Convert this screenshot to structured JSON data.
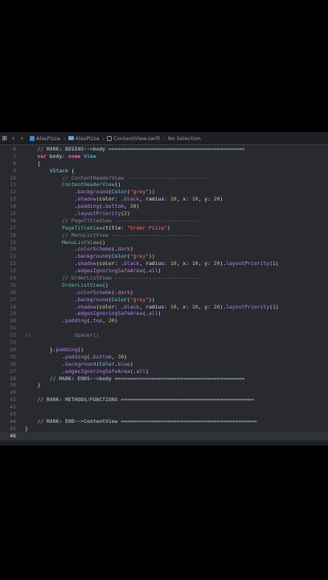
{
  "toolbar": {
    "breadcrumbs": [
      {
        "label": "AlasPizza",
        "icon": "project-icon"
      },
      {
        "label": "AlasPizza",
        "icon": "folder-icon"
      },
      {
        "label": "ContentView.swift",
        "icon": "swift-file-icon"
      }
    ],
    "selection": "No Selection"
  },
  "current_line": "46",
  "lines": [
    {
      "n": "6",
      "t": [
        [
          "mark",
          "    // MARK: BEGINS-->body ============================================"
        ]
      ]
    },
    {
      "n": "7",
      "t": [
        [
          "kw",
          "    var "
        ],
        [
          "plain",
          "body: "
        ],
        [
          "kw",
          "some "
        ],
        [
          "type",
          "View"
        ]
      ]
    },
    {
      "n": "8",
      "t": [
        [
          "plain",
          "    {"
        ]
      ]
    },
    {
      "n": "9",
      "t": [
        [
          "plain",
          "        "
        ],
        [
          "type",
          "VStack"
        ],
        [
          "plain",
          " {"
        ]
      ]
    },
    {
      "n": "10",
      "t": [
        [
          "com",
          "            // ContentHeaderView --------------------------"
        ]
      ]
    },
    {
      "n": "11",
      "t": [
        [
          "plain",
          "            "
        ],
        [
          "func",
          "ContentHeaderView"
        ],
        [
          "plain",
          "()"
        ]
      ]
    },
    {
      "n": "12",
      "t": [
        [
          "plain",
          "                ."
        ],
        [
          "fn",
          "background"
        ],
        [
          "plain",
          "("
        ],
        [
          "type",
          "Color"
        ],
        [
          "plain",
          "("
        ],
        [
          "str",
          "\"grey\""
        ],
        [
          "plain",
          "))"
        ]
      ]
    },
    {
      "n": "13",
      "t": [
        [
          "plain",
          "                ."
        ],
        [
          "fn",
          "shadow"
        ],
        [
          "plain",
          "(color: ."
        ],
        [
          "fn",
          "black"
        ],
        [
          "plain",
          ", radius: "
        ],
        [
          "num",
          "10"
        ],
        [
          "plain",
          ", x: "
        ],
        [
          "num",
          "10"
        ],
        [
          "plain",
          ", y: "
        ],
        [
          "num",
          "20"
        ],
        [
          "plain",
          ")"
        ]
      ]
    },
    {
      "n": "14",
      "t": [
        [
          "plain",
          "                ."
        ],
        [
          "fn",
          "padding"
        ],
        [
          "plain",
          "(."
        ],
        [
          "fn",
          "bottom"
        ],
        [
          "plain",
          ", "
        ],
        [
          "num",
          "20"
        ],
        [
          "plain",
          ")"
        ]
      ]
    },
    {
      "n": "15",
      "t": [
        [
          "plain",
          "                ."
        ],
        [
          "fn",
          "layoutPriority"
        ],
        [
          "plain",
          "("
        ],
        [
          "num",
          "2"
        ],
        [
          "plain",
          ")"
        ]
      ]
    },
    {
      "n": "16",
      "t": [
        [
          "com",
          "            // PageTitleView ---------------------------"
        ]
      ]
    },
    {
      "n": "17",
      "t": [
        [
          "plain",
          "            "
        ],
        [
          "func",
          "PageTitleView"
        ],
        [
          "plain",
          "(title: "
        ],
        [
          "str",
          "\"Order Pizza\""
        ],
        [
          "plain",
          ")"
        ]
      ]
    },
    {
      "n": "18",
      "t": [
        [
          "com",
          "            // MenuListView ----------------------------"
        ]
      ]
    },
    {
      "n": "19",
      "t": [
        [
          "plain",
          "            "
        ],
        [
          "func",
          "MenuListView"
        ],
        [
          "plain",
          "()"
        ]
      ]
    },
    {
      "n": "20",
      "t": [
        [
          "plain",
          "                ."
        ],
        [
          "fn",
          "colorScheme"
        ],
        [
          "plain",
          "(."
        ],
        [
          "fn",
          "dark"
        ],
        [
          "plain",
          ")"
        ]
      ]
    },
    {
      "n": "21",
      "t": [
        [
          "plain",
          "                ."
        ],
        [
          "fn",
          "background"
        ],
        [
          "plain",
          "("
        ],
        [
          "type",
          "Color"
        ],
        [
          "plain",
          "("
        ],
        [
          "str",
          "\"grey\""
        ],
        [
          "plain",
          "))"
        ]
      ]
    },
    {
      "n": "22",
      "t": [
        [
          "plain",
          "                ."
        ],
        [
          "fn",
          "shadow"
        ],
        [
          "plain",
          "(color: ."
        ],
        [
          "fn",
          "black"
        ],
        [
          "plain",
          ", radius: "
        ],
        [
          "num",
          "10"
        ],
        [
          "plain",
          ", x: "
        ],
        [
          "num",
          "10"
        ],
        [
          "plain",
          ", y: "
        ],
        [
          "num",
          "20"
        ],
        [
          "plain",
          ")."
        ],
        [
          "fn",
          "layoutPriority"
        ],
        [
          "plain",
          "("
        ],
        [
          "num",
          "1"
        ],
        [
          "plain",
          ")"
        ]
      ]
    },
    {
      "n": "23",
      "t": [
        [
          "plain",
          "                ."
        ],
        [
          "fn",
          "edgesIgnoringSafeArea"
        ],
        [
          "plain",
          "(."
        ],
        [
          "fn",
          "all"
        ],
        [
          "plain",
          ")"
        ]
      ]
    },
    {
      "n": "24",
      "t": [
        [
          "com",
          "            // OrderListView ---------------------------"
        ]
      ]
    },
    {
      "n": "25",
      "t": [
        [
          "plain",
          "            "
        ],
        [
          "func",
          "OrderListView"
        ],
        [
          "plain",
          "()"
        ]
      ]
    },
    {
      "n": "26",
      "t": [
        [
          "plain",
          "                ."
        ],
        [
          "fn",
          "colorScheme"
        ],
        [
          "plain",
          "(."
        ],
        [
          "fn",
          "dark"
        ],
        [
          "plain",
          ")"
        ]
      ]
    },
    {
      "n": "27",
      "t": [
        [
          "plain",
          "                ."
        ],
        [
          "fn",
          "background"
        ],
        [
          "plain",
          "("
        ],
        [
          "type",
          "Color"
        ],
        [
          "plain",
          "("
        ],
        [
          "str",
          "\"grey\""
        ],
        [
          "plain",
          "))"
        ]
      ]
    },
    {
      "n": "28",
      "t": [
        [
          "plain",
          "                ."
        ],
        [
          "fn",
          "shadow"
        ],
        [
          "plain",
          "(color: ."
        ],
        [
          "fn",
          "black"
        ],
        [
          "plain",
          ", radius: "
        ],
        [
          "num",
          "10"
        ],
        [
          "plain",
          ", x: "
        ],
        [
          "num",
          "10"
        ],
        [
          "plain",
          ", y: "
        ],
        [
          "num",
          "20"
        ],
        [
          "plain",
          ")."
        ],
        [
          "fn",
          "layoutPriority"
        ],
        [
          "plain",
          "("
        ],
        [
          "num",
          "1"
        ],
        [
          "plain",
          ")"
        ]
      ]
    },
    {
      "n": "29",
      "t": [
        [
          "plain",
          "                ."
        ],
        [
          "fn",
          "edgesIgnoringSafeArea"
        ],
        [
          "plain",
          "(."
        ],
        [
          "fn",
          "all"
        ],
        [
          "plain",
          ")"
        ]
      ]
    },
    {
      "n": "30",
      "t": [
        [
          "plain",
          "            ."
        ],
        [
          "fn",
          "padding"
        ],
        [
          "plain",
          "(."
        ],
        [
          "fn",
          "top"
        ],
        [
          "plain",
          ", "
        ],
        [
          "num",
          "20"
        ],
        [
          "plain",
          ")"
        ]
      ]
    },
    {
      "n": "31",
      "t": []
    },
    {
      "n": "32",
      "t": [
        [
          "com",
          "//              Spacer()"
        ]
      ]
    },
    {
      "n": "33",
      "t": []
    },
    {
      "n": "34",
      "t": [
        [
          "plain",
          "        }."
        ],
        [
          "fn",
          "padding"
        ],
        [
          "plain",
          "()"
        ]
      ]
    },
    {
      "n": "35",
      "t": [
        [
          "plain",
          "            ."
        ],
        [
          "fn",
          "padding"
        ],
        [
          "plain",
          "(."
        ],
        [
          "fn",
          "bottom"
        ],
        [
          "plain",
          ", "
        ],
        [
          "num",
          "30"
        ],
        [
          "plain",
          ")"
        ]
      ]
    },
    {
      "n": "36",
      "t": [
        [
          "plain",
          "            ."
        ],
        [
          "fn",
          "background"
        ],
        [
          "plain",
          "("
        ],
        [
          "type",
          "Color"
        ],
        [
          "plain",
          "."
        ],
        [
          "fn",
          "blue"
        ],
        [
          "plain",
          ")"
        ]
      ]
    },
    {
      "n": "37",
      "t": [
        [
          "plain",
          "            ."
        ],
        [
          "fn",
          "edgesIgnoringSafeArea"
        ],
        [
          "plain",
          "(."
        ],
        [
          "fn",
          "all"
        ],
        [
          "plain",
          ")"
        ]
      ]
    },
    {
      "n": "38",
      "t": [
        [
          "mark",
          "        // MARK: ENDS-->body =========================================="
        ]
      ]
    },
    {
      "n": "39",
      "t": [
        [
          "plain",
          "    }"
        ]
      ]
    },
    {
      "n": "40",
      "t": []
    },
    {
      "n": "41",
      "t": [
        [
          "mark",
          "    // MARK: METHODS/FUNCTIONS ==========================================="
        ]
      ]
    },
    {
      "n": "42",
      "t": []
    },
    {
      "n": "43",
      "t": []
    },
    {
      "n": "44",
      "t": [
        [
          "mark",
          "    // MARK: END-->ContentView ============================================"
        ]
      ]
    },
    {
      "n": "45",
      "t": [
        [
          "plain",
          "}"
        ]
      ]
    },
    {
      "n": "46",
      "t": []
    }
  ]
}
